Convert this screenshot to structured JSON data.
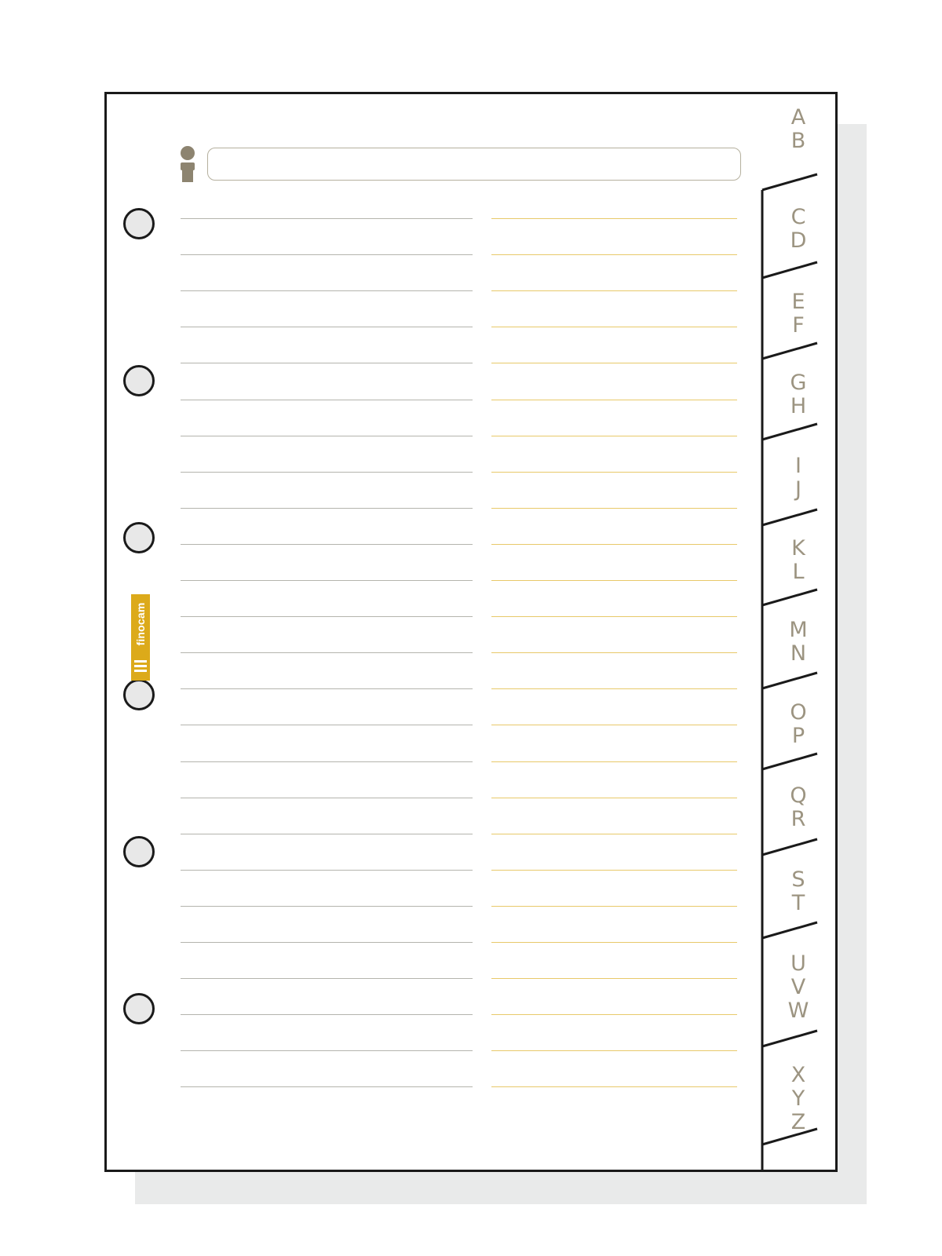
{
  "sheet": {
    "name_field": {
      "value": "",
      "placeholder": ""
    },
    "logo": {
      "text": "finocam",
      "color": "#dcaa1a"
    },
    "icons": {
      "contact": "person-icon"
    },
    "colors": {
      "left_column_lines": "#b4b4ad",
      "right_column_lines": "#e8c96a",
      "tab_letters": "#9c9481",
      "border": "#1a1a1a"
    },
    "ruled_line_count_per_column": 25,
    "tabs": [
      {
        "letters": [
          "A",
          "B"
        ]
      },
      {
        "letters": [
          "C",
          "D"
        ]
      },
      {
        "letters": [
          "E",
          "F"
        ]
      },
      {
        "letters": [
          "G",
          "H"
        ]
      },
      {
        "letters": [
          "I",
          "J"
        ]
      },
      {
        "letters": [
          "K",
          "L"
        ]
      },
      {
        "letters": [
          "M",
          "N"
        ]
      },
      {
        "letters": [
          "O",
          "P"
        ]
      },
      {
        "letters": [
          "Q",
          "R"
        ]
      },
      {
        "letters": [
          "S",
          "T"
        ]
      },
      {
        "letters": [
          "U",
          "V",
          "W"
        ]
      },
      {
        "letters": [
          "X",
          "Y",
          "Z"
        ]
      }
    ]
  }
}
